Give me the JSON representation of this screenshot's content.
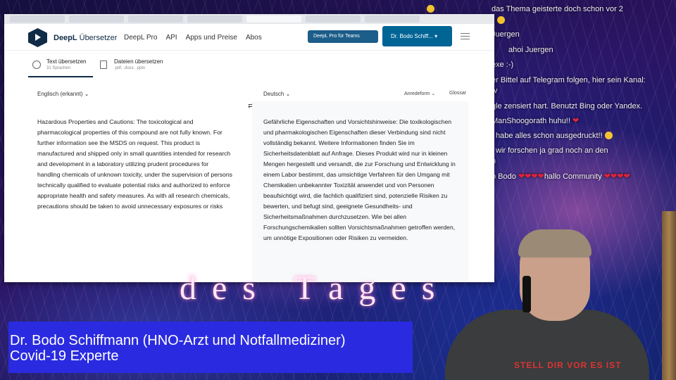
{
  "chat": {
    "lines": [
      "das Thema geisterte doch schon vor 2",
      "",
      "Juergen",
      "ahoi Juergen",
      "exe :-)",
      "er Bittel auf Telegram folgen, hier sein Kanal:",
      "tv",
      "gle zensiert hart. Benutzt Bing oder Yandex.",
      "ManShoogorath huhu!!",
      "habe alles schon ausgedruckt!!",
      "wir forschen ja grad noch an den",
      "n",
      "o Bodo",
      "hallo Community"
    ]
  },
  "browser": {
    "tabs": [
      "",
      "",
      "",
      "",
      "",
      "",
      ""
    ]
  },
  "app": {
    "brand": "DeepL",
    "product": "Übersetzer",
    "nav": [
      "DeepL Pro",
      "API",
      "Apps und Preise",
      "Abos"
    ],
    "team_button": "DeepL Pro für Teams",
    "account_button": "Dr. Bodo Schiff..."
  },
  "modes": [
    {
      "title": "Text übersetzen",
      "sub": "31 Sprachen",
      "icon": "globe-icon"
    },
    {
      "title": "Dateien übersetzen",
      "sub": ".pdf, .docx, .pptx",
      "icon": "document-icon"
    }
  ],
  "source": {
    "language": "Englisch (erkannt)",
    "text": "Hazardous Properties and Cautions: The toxicological and pharmacological properties of this compound are not fully known. For further information see the MSDS on request. This product is manufactured and shipped only in small quantities intended for research and development in a laboratory utilizing prudent procedures for handling chemicals of unknown toxicity, under the supervision of persons technically qualified to evaluate potential risks and authorized to enforce appropriate health and safety measures. As with all research chemicals, precautions should be taken to avoid unnecessary exposures or risks"
  },
  "target": {
    "language": "Deutsch",
    "options": [
      "Anredeform",
      "Glossar"
    ],
    "text": "Gefährliche Eigenschaften und Vorsichtshinweise: Die toxikologischen und pharmakologischen Eigenschaften dieser Verbindung sind nicht vollständig bekannt. Weitere Informationen finden Sie im Sicherheitsdatenblatt auf Anfrage. Dieses Produkt wird nur in kleinen Mengen hergestellt und versandt, die zur Forschung und Entwicklung in einem Labor bestimmt, das umsichtige Verfahren für den Umgang mit Chemikalien unbekannter Toxizität anwendet und von Personen beaufsichtigt wird, die fachlich qualifiziert sind, potenzielle Risiken zu bewerten, und befugt sind, geeignete Gesundheits- und Sicherheitsmaßnahmen durchzusetzen. Wie bei allen Forschungschemikalien sollten Vorsichtsmaßnahmen getroffen werden, um unnötige Expositionen oder Risiken zu vermeiden."
  },
  "overlay": {
    "title": "des Tages",
    "banner_line1": "Dr. Bodo Schiffmann (HNO-Arzt und  Notfallmediziner)",
    "banner_line2": "Covid-19 Experte",
    "shirt_text": "STELL DIR VOR ES IST"
  }
}
